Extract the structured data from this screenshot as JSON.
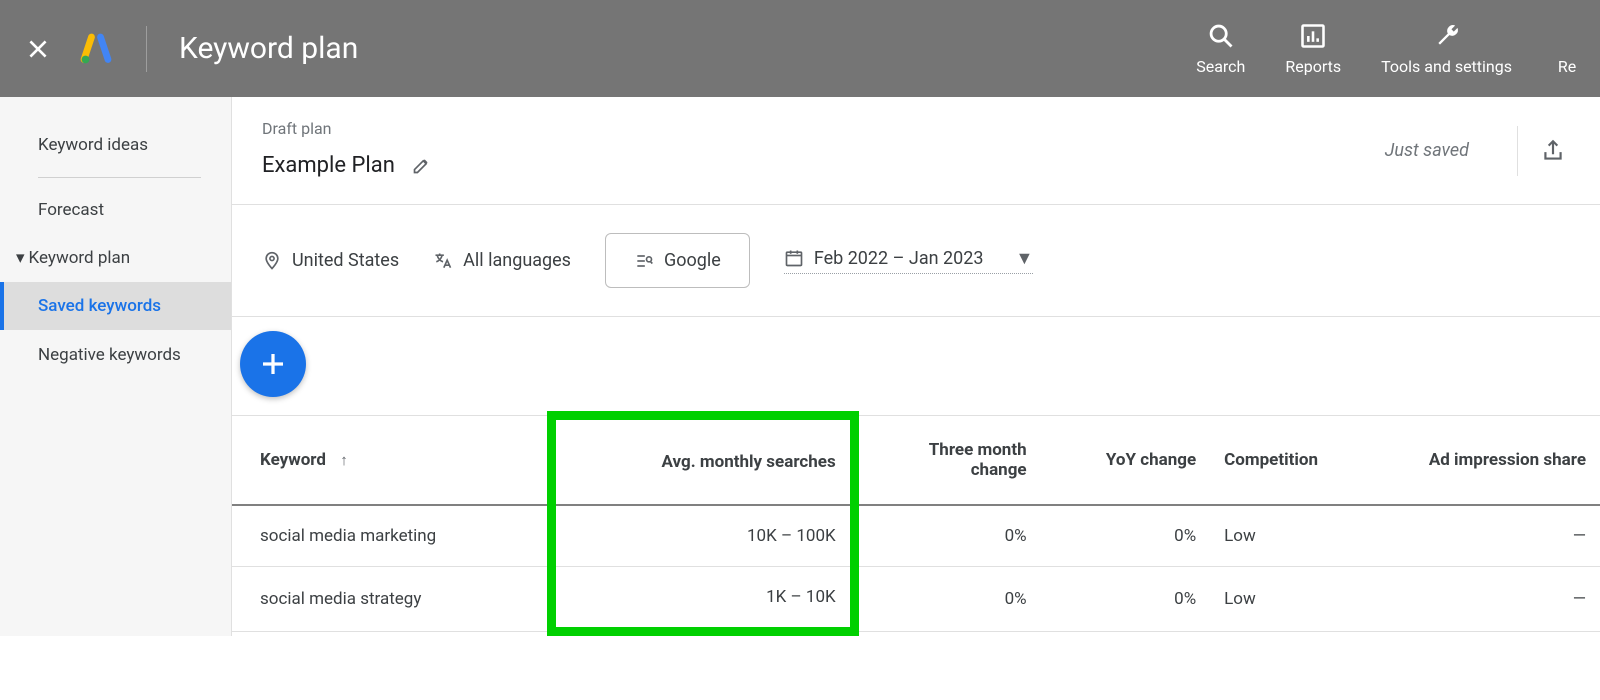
{
  "header": {
    "title": "Keyword plan",
    "nav": {
      "search": "Search",
      "reports": "Reports",
      "tools": "Tools and settings",
      "re": "Re"
    }
  },
  "sidebar": {
    "ideas": "Keyword ideas",
    "forecast": "Forecast",
    "plan": "Keyword plan",
    "saved": "Saved keywords",
    "negative": "Negative keywords"
  },
  "plan": {
    "draft_label": "Draft plan",
    "name": "Example Plan",
    "just_saved": "Just saved"
  },
  "filters": {
    "location": "United States",
    "language": "All languages",
    "network": "Google",
    "date_range": "Feb 2022 – Jan 2023"
  },
  "table": {
    "columns": {
      "keyword": "Keyword",
      "avg": "Avg. monthly searches",
      "three_month": "Three month change",
      "yoy": "YoY change",
      "competition": "Competition",
      "ad_share": "Ad impression share"
    },
    "rows": [
      {
        "keyword": "social media marketing",
        "avg": "10K – 100K",
        "three_month": "0%",
        "yoy": "0%",
        "competition": "Low",
        "ad_share": "—"
      },
      {
        "keyword": "social media strategy",
        "avg": "1K – 10K",
        "three_month": "0%",
        "yoy": "0%",
        "competition": "Low",
        "ad_share": "—"
      }
    ]
  }
}
